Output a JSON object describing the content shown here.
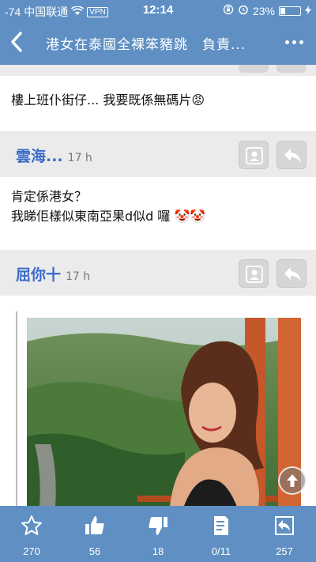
{
  "status_bar": {
    "signal": "-74",
    "carrier": "中国联通",
    "vpn": "VPN",
    "time": "12:14",
    "battery_percent": "23%",
    "battery_level": 0.23
  },
  "nav": {
    "title": "港女在泰國全裸笨豬跳　負責..."
  },
  "posts": [
    {
      "body": "樓上班仆街仔... 我要既係無碼片😡"
    },
    {
      "author": "雲海...",
      "time": "17 h",
      "body_line1": "肯定係港女？",
      "body_line2": "我睇佢樣似東南亞果d似d 囉 🤡🤡"
    },
    {
      "author": "屈你十",
      "time": "17 h"
    }
  ],
  "toolbar": {
    "favorites": "270",
    "likes": "56",
    "dislikes": "18",
    "pages": "0/11",
    "replies": "257"
  },
  "colors": {
    "bar": "#5f8fc3",
    "author": "#3b6bc8",
    "header_bg": "#ebebeb"
  }
}
